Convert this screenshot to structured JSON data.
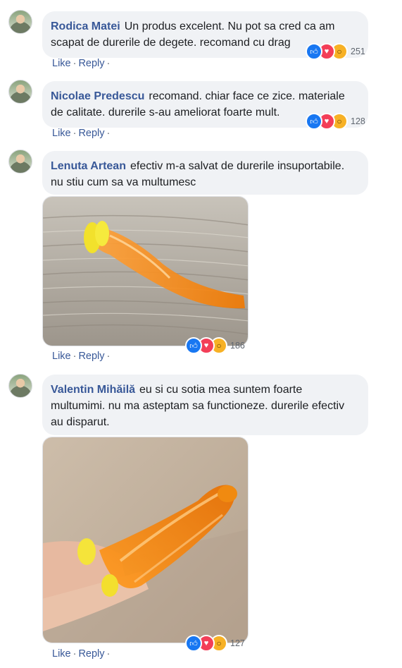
{
  "actions": {
    "like": "Like",
    "reply": "Reply",
    "dot": "·"
  },
  "colors": {
    "link": "#385898",
    "bubble": "#f0f2f5",
    "like": "#1877f2",
    "love": "#f33e58",
    "wow": "#f7b125"
  },
  "comments": [
    {
      "author": "Rodica Matei",
      "text": "Un produs excelent. Nu pot sa cred ca am scapat de durerile de degete. recomand cu drag",
      "reactions": {
        "icons": [
          "like-icon",
          "love-icon",
          "wow-icon"
        ],
        "count": "251"
      }
    },
    {
      "author": "Nicolae Predescu",
      "text": "recomand. chiar face ce zice. materiale de calitate. durerile s-au ameliorat foarte mult.",
      "reactions": {
        "icons": [
          "like-icon",
          "love-icon",
          "wow-icon"
        ],
        "count": "128"
      }
    },
    {
      "author": "Lenuta Artean",
      "text": "efectiv m-a salvat de durerile insuportabile. nu stiu cum sa va multumesc",
      "reactions": {
        "icons": [
          "like-icon",
          "love-icon",
          "wow-icon"
        ],
        "count": "186"
      }
    },
    {
      "author": "Valentin Mihăilă",
      "text": "eu si cu sotia mea suntem foarte multumimi. nu ma asteptam sa functioneze. durerile efectiv au disparut.",
      "reactions": {
        "icons": [
          "like-icon",
          "love-icon",
          "wow-icon"
        ],
        "count": "127"
      }
    }
  ]
}
